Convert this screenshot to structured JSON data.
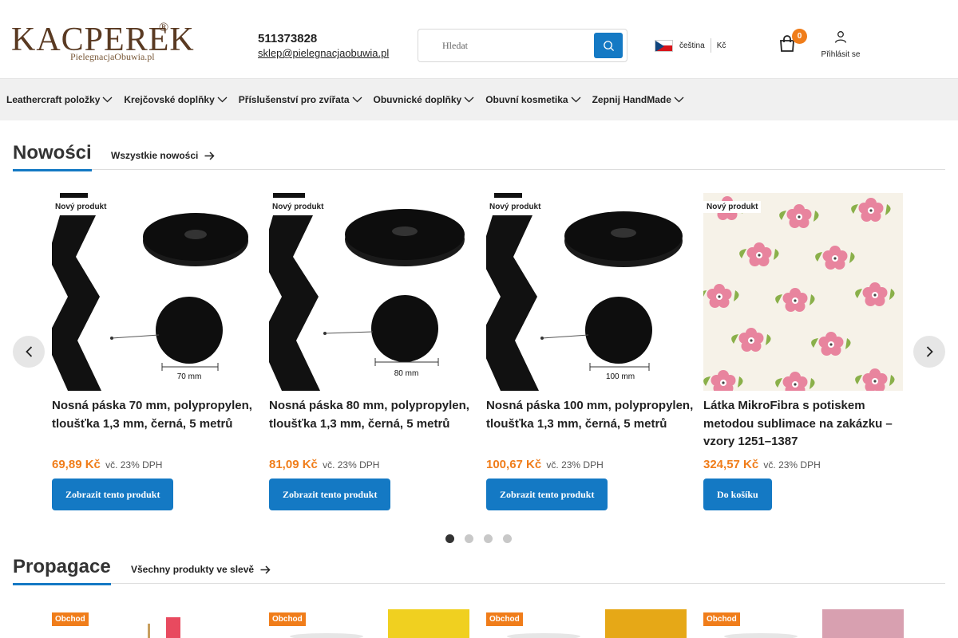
{
  "header": {
    "logo_text": "KACPEREK",
    "logo_sub": "PielegnacjaObuwia.pl",
    "logo_mark": "®",
    "phone": "511373828",
    "email": "sklep@pielegnacjaobuwia.pl",
    "search_placeholder": "Hledat",
    "language": "čeština",
    "currency": "Kč",
    "cart_count": "0",
    "login_label": "Přihlásit se"
  },
  "nav": {
    "items": [
      {
        "label": "Leathercraft položky"
      },
      {
        "label": "Krejčovské doplňky"
      },
      {
        "label": "Příslušenství pro zvířata"
      },
      {
        "label": "Obuvnické doplňky"
      },
      {
        "label": "Obuvní kosmetika"
      },
      {
        "label": "Zepnij HandMade"
      }
    ]
  },
  "news": {
    "title": "Nowości",
    "link": "Wszystkie nowości",
    "products": [
      {
        "tag": "Nový produkt",
        "name": "Nosná páska 70 mm, polypropylen, tloušťka 1,3 mm, černá, 5 metrů",
        "price": "69,89 Kč",
        "vat": "vč. 23% DPH",
        "button": "Zobrazit tento produkt",
        "dimension": "70 mm"
      },
      {
        "tag": "Nový produkt",
        "name": "Nosná páska 80 mm, polypropylen, tloušťka 1,3 mm, černá, 5 metrů",
        "price": "81,09 Kč",
        "vat": "vč. 23% DPH",
        "button": "Zobrazit tento produkt",
        "dimension": "80 mm"
      },
      {
        "tag": "Nový produkt",
        "name": "Nosná páska 100 mm, polypropylen, tloušťka 1,3 mm, černá, 5 metrů",
        "price": "100,67 Kč",
        "vat": "vč. 23% DPH",
        "button": "Zobrazit tento produkt",
        "dimension": "100 mm"
      },
      {
        "tag": "Nový produkt",
        "name": "Látka MikroFibra s potiskem metodou sublimace na zakázku – vzory 1251–1387",
        "price": "324,57 Kč",
        "vat": "vč. 23% DPH",
        "button": "Do košíku"
      }
    ],
    "active_page": 1,
    "pages": 4
  },
  "promo": {
    "title": "Propagace",
    "link": "Všechny produkty ve slevě",
    "tags": [
      "Obchod",
      "Obchod",
      "Obchod",
      "Obchod"
    ]
  },
  "colors": {
    "accent": "#1479c4",
    "price": "#f07d1a",
    "logo": "#5a3a22"
  }
}
